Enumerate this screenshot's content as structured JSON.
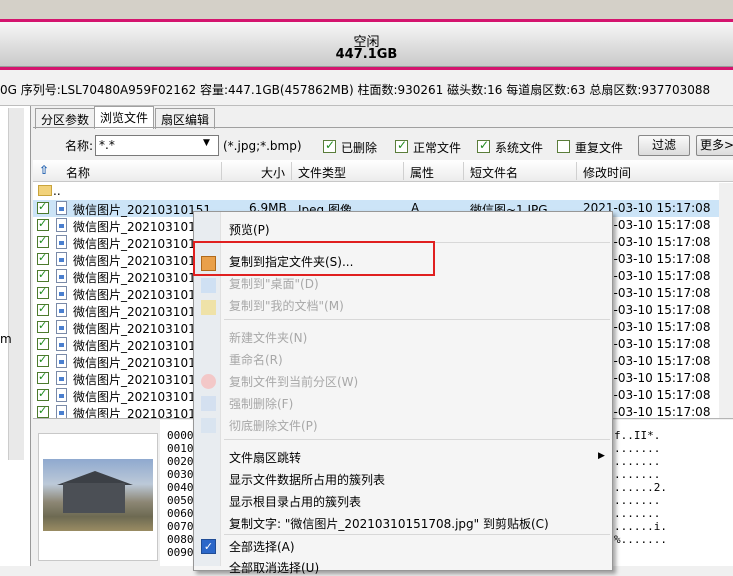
{
  "disk": {
    "label": "空闲",
    "size": "447.1GB",
    "info": "0G  序列号:LSL70480A959F02162  容量:447.1GB(457862MB)  柱面数:930261  磁头数:16  每道扇区数:63  总扇区数:937703088"
  },
  "left": {
    "fragment": "m"
  },
  "tabs": [
    {
      "label": "分区参数",
      "active": false
    },
    {
      "label": "浏览文件",
      "active": true
    },
    {
      "label": "扇区编辑",
      "active": false
    }
  ],
  "filter": {
    "name_label": "名称:",
    "name_value": "*.*",
    "ext": "(*.jpg;*.bmp)",
    "checks": [
      {
        "label": "已删除",
        "checked": true
      },
      {
        "label": "正常文件",
        "checked": true
      },
      {
        "label": "系统文件",
        "checked": true
      },
      {
        "label": "重复文件",
        "checked": false
      }
    ],
    "filter_button": "过滤",
    "more_button": "更多>>"
  },
  "columns": [
    "名称",
    "大小",
    "文件类型",
    "属性",
    "短文件名",
    "修改时间"
  ],
  "parent_row": "..",
  "rows": [
    {
      "name": "微信图片_20210310151...",
      "size": "6.9MB",
      "type": "Jpeg 图像",
      "attr": "A",
      "short": "微信图~1.JPG",
      "time": "2021-03-10 15:17:08",
      "selected": true
    },
    {
      "name": "微信图片_2021031015",
      "time": "2021-03-10 15:17:08"
    },
    {
      "name": "微信图片_2021031015",
      "time": "2021-03-10 15:17:08"
    },
    {
      "name": "微信图片_2021031015",
      "time": "2021-03-10 15:17:08"
    },
    {
      "name": "微信图片_2021031015",
      "time": "2021-03-10 15:17:08"
    },
    {
      "name": "微信图片_2021031015",
      "time": "2021-03-10 15:17:08"
    },
    {
      "name": "微信图片_2021031015",
      "time": "2021-03-10 15:17:08"
    },
    {
      "name": "微信图片_2021031015",
      "time": "2021-03-10 15:17:08"
    },
    {
      "name": "微信图片_2021031015",
      "time": "2021-03-10 15:17:08"
    },
    {
      "name": "微信图片_2021031015",
      "time": "2021-03-10 15:17:08"
    },
    {
      "name": "微信图片_2021031015",
      "time": "2021-03-10 15:17:08"
    },
    {
      "name": "微信图片_2021031015",
      "time": "2021-03-10 15:17:08"
    },
    {
      "name": "微信图片_2021031015",
      "time": "2021-03-10 15:17:08"
    }
  ],
  "hex_offsets": [
    "0000",
    "0010",
    "0020",
    "0030",
    "0040",
    "0050",
    "0060",
    "0070",
    "0080",
    "0090"
  ],
  "hex_ascii": [
    "f..II*.",
    ".......",
    ".......",
    ".......",
    "......2.",
    ".......",
    ".......",
    "......i.",
    "%......."
  ],
  "menu": {
    "items": [
      {
        "label": "预览(P)",
        "disabled": false
      },
      {
        "label": "复制到指定文件夹(S)...",
        "disabled": false
      },
      {
        "label": "复制到\"桌面\"(D)",
        "disabled": true
      },
      {
        "label": "复制到\"我的文档\"(M)",
        "disabled": true
      },
      {
        "label": "新建文件夹(N)",
        "disabled": true
      },
      {
        "label": "重命名(R)",
        "disabled": true
      },
      {
        "label": "复制文件到当前分区(W)",
        "disabled": true
      },
      {
        "label": "强制删除(F)",
        "disabled": true
      },
      {
        "label": "彻底删除文件(P)",
        "disabled": true
      },
      {
        "label": "文件扇区跳转",
        "disabled": false
      },
      {
        "label": "显示文件数据所占用的簇列表",
        "disabled": false
      },
      {
        "label": "显示根目录占用的簇列表",
        "disabled": false
      },
      {
        "label": "复制文字: \"微信图片_20210310151708.jpg\" 到剪贴板(C)",
        "disabled": false
      },
      {
        "label": "全部选择(A)",
        "disabled": false
      },
      {
        "label": "全部取消选择(U)",
        "disabled": false
      }
    ]
  },
  "colors": {
    "accent_pink": "#d4146e",
    "highlight_red": "#e02020",
    "selection": "#cce4f7"
  }
}
